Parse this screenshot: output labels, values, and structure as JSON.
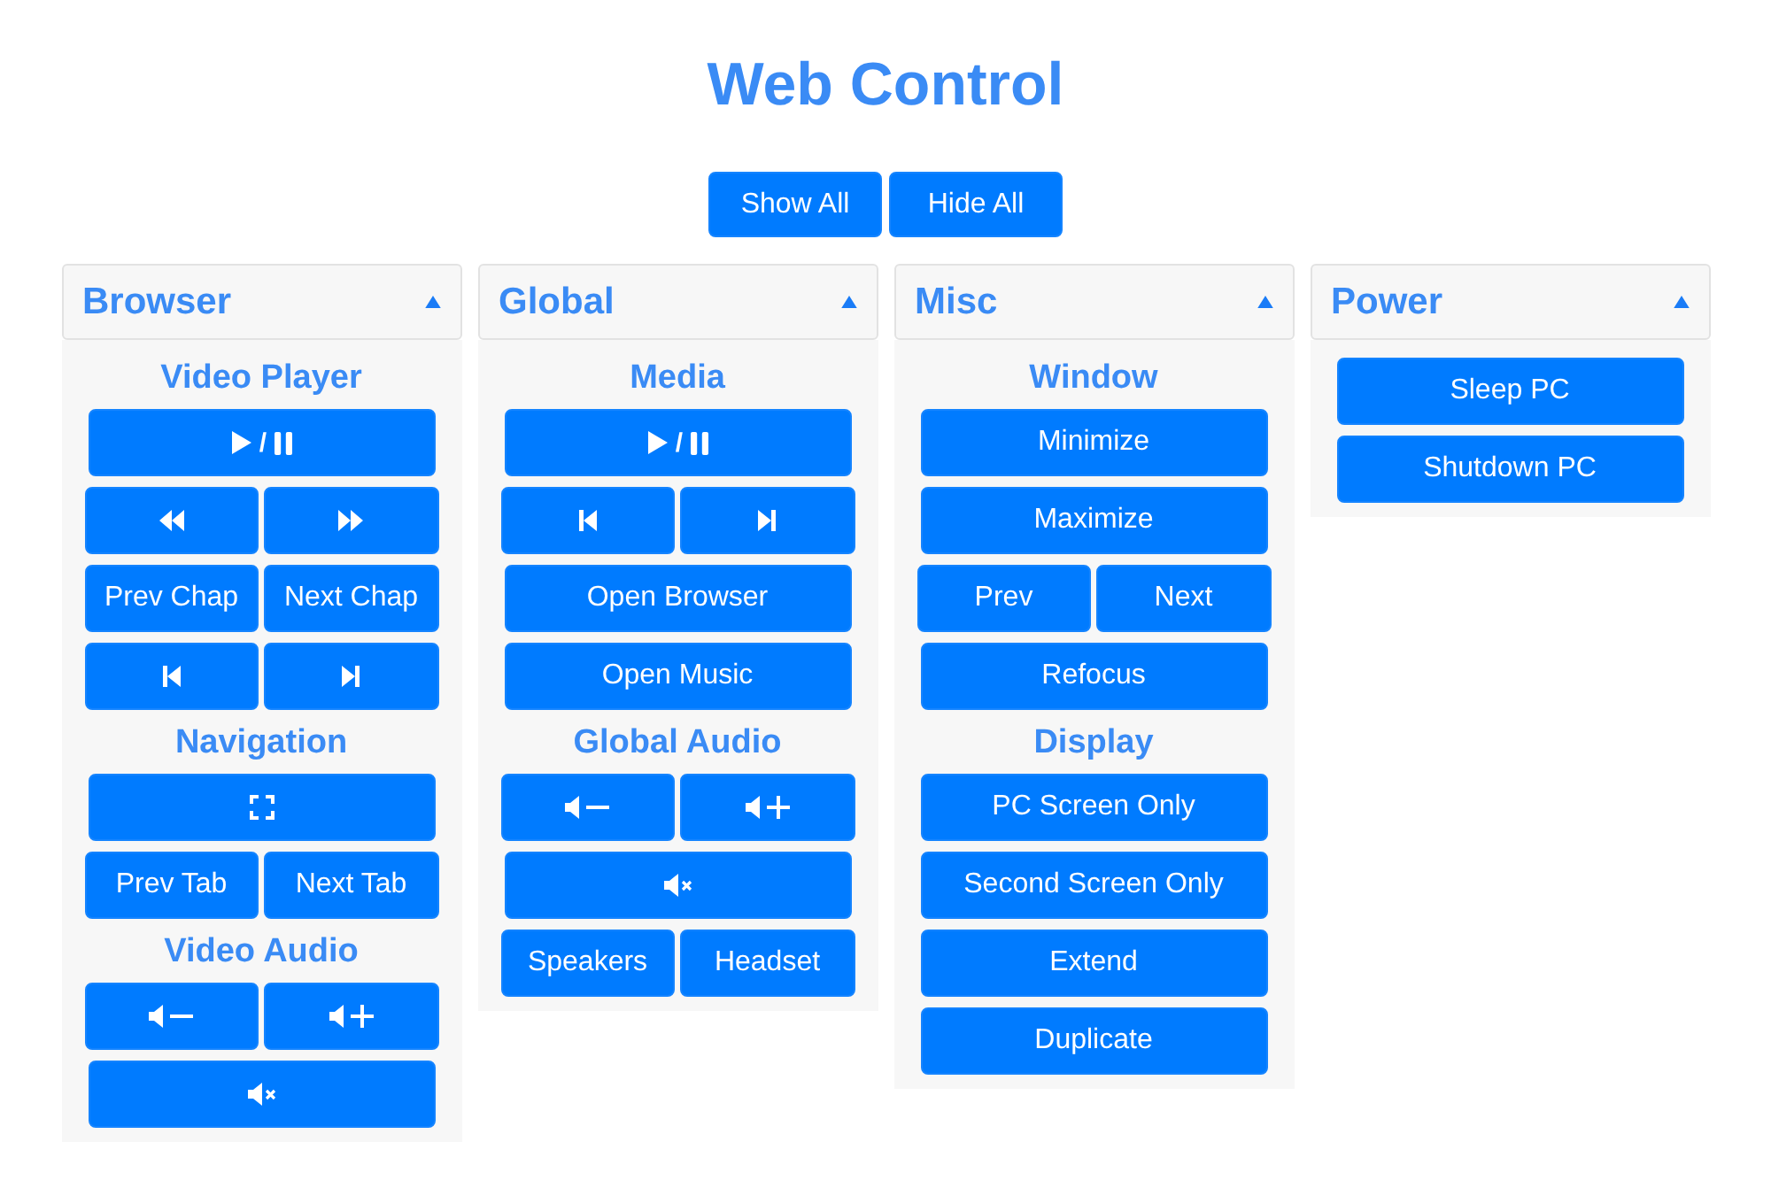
{
  "title": "Web Control",
  "toolbar": [
    {
      "label": "Show All"
    },
    {
      "label": "Hide All"
    }
  ],
  "panels": [
    {
      "title": "Browser",
      "expanded": true,
      "sections": [
        {
          "heading": "Video Player",
          "rows": [
            [
              {
                "kind": "playpause",
                "label": "/"
              }
            ],
            [
              {
                "kind": "rewind"
              },
              {
                "kind": "forward"
              }
            ],
            [
              {
                "kind": "text",
                "label": "Prev Chap"
              },
              {
                "kind": "text",
                "label": "Next Chap"
              }
            ],
            [
              {
                "kind": "previous"
              },
              {
                "kind": "next"
              }
            ]
          ]
        },
        {
          "heading": "Navigation",
          "rows": [
            [
              {
                "kind": "fullscreen"
              }
            ],
            [
              {
                "kind": "text",
                "label": "Prev Tab"
              },
              {
                "kind": "text",
                "label": "Next Tab"
              }
            ]
          ]
        },
        {
          "heading": "Video Audio",
          "rows": [
            [
              {
                "kind": "voldown"
              },
              {
                "kind": "volup"
              }
            ],
            [
              {
                "kind": "mute"
              }
            ]
          ]
        }
      ]
    },
    {
      "title": "Global",
      "expanded": true,
      "sections": [
        {
          "heading": "Media",
          "rows": [
            [
              {
                "kind": "playpause",
                "label": "/"
              }
            ],
            [
              {
                "kind": "previous"
              },
              {
                "kind": "next"
              }
            ],
            [
              {
                "kind": "text",
                "label": "Open Browser"
              }
            ],
            [
              {
                "kind": "text",
                "label": "Open Music"
              }
            ]
          ]
        },
        {
          "heading": "Global Audio",
          "rows": [
            [
              {
                "kind": "voldown"
              },
              {
                "kind": "volup"
              }
            ],
            [
              {
                "kind": "mute"
              }
            ],
            [
              {
                "kind": "text",
                "label": "Speakers"
              },
              {
                "kind": "text",
                "label": "Headset"
              }
            ]
          ]
        }
      ]
    },
    {
      "title": "Misc",
      "expanded": true,
      "sections": [
        {
          "heading": "Window",
          "rows": [
            [
              {
                "kind": "text",
                "label": "Minimize"
              }
            ],
            [
              {
                "kind": "text",
                "label": "Maximize"
              }
            ],
            [
              {
                "kind": "text",
                "label": "Prev"
              },
              {
                "kind": "text",
                "label": "Next"
              }
            ],
            [
              {
                "kind": "text",
                "label": "Refocus"
              }
            ]
          ]
        },
        {
          "heading": "Display",
          "rows": [
            [
              {
                "kind": "text",
                "label": "PC Screen Only"
              }
            ],
            [
              {
                "kind": "text",
                "label": "Second Screen Only"
              }
            ],
            [
              {
                "kind": "text",
                "label": "Extend"
              }
            ],
            [
              {
                "kind": "text",
                "label": "Duplicate"
              }
            ]
          ]
        }
      ]
    },
    {
      "title": "Power",
      "expanded": true,
      "sections": [
        {
          "rows": [
            [
              {
                "kind": "text",
                "label": "Sleep PC"
              }
            ],
            [
              {
                "kind": "text",
                "label": "Shutdown PC"
              }
            ]
          ]
        }
      ]
    }
  ]
}
